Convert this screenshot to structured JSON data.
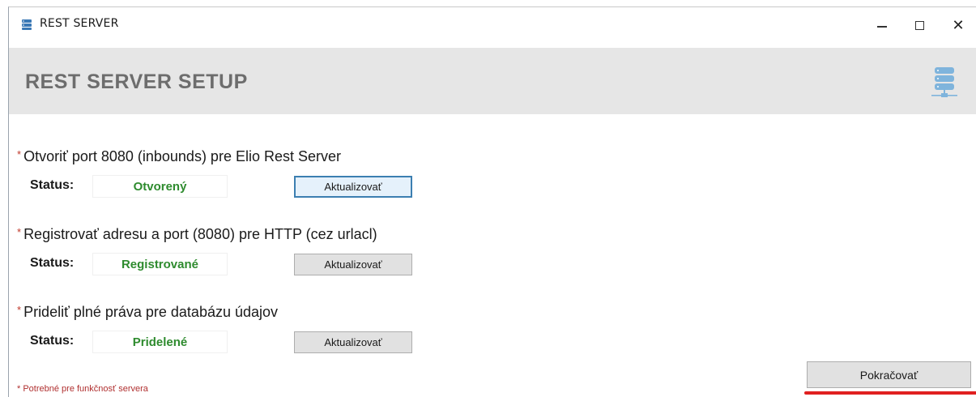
{
  "window": {
    "title": "REST SERVER",
    "controls": {
      "minimize_icon": "minimize-icon",
      "maximize_icon": "maximize-icon",
      "close_glyph": "✕"
    }
  },
  "header": {
    "title": "REST SERVER SETUP",
    "icon": "server-stack-icon",
    "icon_color": "#7fb4dc"
  },
  "sections": [
    {
      "label": "Otvoriť port 8080 (inbounds) pre Elio Rest Server",
      "status_label": "Status:",
      "status_value": "Otvorený",
      "button_label": "Aktualizovať"
    },
    {
      "label": "Registrovať adresu a port (8080) pre HTTP (cez urlacl)",
      "status_label": "Status:",
      "status_value": "Registrované",
      "button_label": "Aktualizovať"
    },
    {
      "label": "Prideliť plné práva pre databázu údajov",
      "status_label": "Status:",
      "status_value": "Pridelené",
      "button_label": "Aktualizovať"
    }
  ],
  "required_marker": "*",
  "footnote": "* Potrebné pre funkčnosť servera",
  "continue_button": "Pokračovať",
  "colors": {
    "status_ok": "#2e8b2e",
    "required": "#c0392b",
    "header_bg": "#e6e6e6",
    "highlight": "#e02020"
  }
}
